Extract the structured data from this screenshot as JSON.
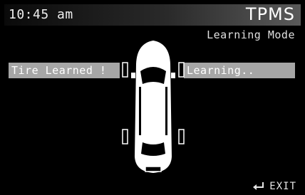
{
  "header": {
    "time": "10:45 am",
    "title": "TPMS"
  },
  "mode": {
    "label": "Learning Mode"
  },
  "tires": {
    "left_status": "Tire Learned !",
    "right_status": "Learning.."
  },
  "footer": {
    "exit_label": "EXIT"
  },
  "icons": [
    "car-top-view-icon",
    "tire-indicator-icon",
    "enter-return-icon"
  ],
  "colors": {
    "background": "#000000",
    "status_box": "#a6a6a6",
    "text": "#e6e6e6"
  }
}
